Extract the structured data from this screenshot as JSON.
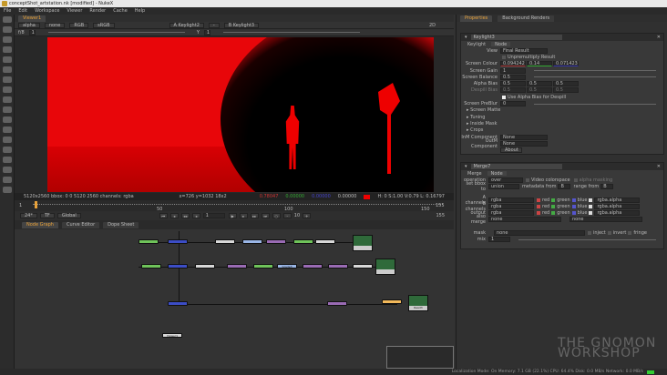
{
  "window": {
    "title": "conceptShot_artstation.nk [modified] - NukeX"
  },
  "menu": [
    "File",
    "Edit",
    "Workspace",
    "Viewer",
    "Render",
    "Cache",
    "Help"
  ],
  "viewer": {
    "tab": "Viewer1",
    "controls": {
      "channel": "alpha",
      "mask": "none",
      "display": "RGB",
      "colorspace": "sRGB",
      "input_a": "A  Keylight2",
      "dash": "-",
      "input_b": "B  Keylight3",
      "gain": "f/8",
      "gain_val": "1",
      "gamma_label": "Y",
      "gamma_val": "1",
      "zoom": "2D"
    },
    "info": {
      "format": "5120x2560  bbox: 0 0 5120 2560 channels: rgba",
      "coords": "x=726 y=1032 18x2",
      "r": "0.78047",
      "g": "0.00000",
      "b": "0.00000",
      "a": "0.00000",
      "hsv": "H: 0 S:1.00 V:0.79  L: 0.16797"
    },
    "sample_color": "#e00000",
    "timeline": {
      "labels": [
        "1",
        "50",
        "100",
        "150",
        "155"
      ],
      "frame": "1",
      "fps": "24*",
      "tf": "TF",
      "range": "Global",
      "increment": "10",
      "end": "155"
    }
  },
  "nodegraph": {
    "tabs": [
      "Node Graph",
      "Curve Editor",
      "Dope Sheet"
    ],
    "nodes": [
      "Read3",
      "Grade3",
      "Viewer1"
    ]
  },
  "properties": {
    "tabs": [
      "Properties",
      "Background Renders"
    ],
    "keylight": {
      "name": "Keylight3",
      "tabs": [
        "Keylight",
        "Node"
      ],
      "view": "Final Result",
      "unpremult": "Unpremultiply Result",
      "rows": [
        {
          "label": "Screen Colour",
          "values": [
            "0.094242",
            "0.14",
            "0.071423"
          ]
        },
        {
          "label": "Screen Gain",
          "values": [
            "1"
          ]
        },
        {
          "label": "Screen Balance",
          "values": [
            "0.5"
          ]
        },
        {
          "label": "Alpha Bias",
          "values": [
            "0.5",
            "0.5",
            "0.5"
          ]
        },
        {
          "label": "Despill Bias",
          "values": [
            "0.5",
            "0.5",
            "0.5"
          ]
        }
      ],
      "view_label": "View",
      "use_alpha_bias": "Use Alpha Bias for Despill",
      "preblur_label": "Screen PreBlur",
      "preblur": "0",
      "groups": [
        "Screen Matte",
        "Tuning",
        "Inside Mask",
        "Crops"
      ],
      "inm_label": "InM Component",
      "inm": "None",
      "outm_label": "OutM Component",
      "outm": "None",
      "about": "About"
    },
    "merge": {
      "name": "Merge7",
      "tabs": [
        "Merge",
        "Node"
      ],
      "operation_label": "operation",
      "operation": "over",
      "video_colorspace": "Video colorspace",
      "alpha_masking": "alpha masking",
      "bbox_label": "set bbox to",
      "bbox": "union",
      "metadata_label": "metadata from",
      "metadata": "B",
      "range_label": "range from",
      "range": "B",
      "channels": [
        {
          "label": "A channels",
          "value": "rgba",
          "alpha": "rgba.alpha"
        },
        {
          "label": "B channels",
          "value": "rgba",
          "alpha": "rgba.alpha"
        },
        {
          "label": "output",
          "value": "rgba",
          "alpha": "rgba.alpha"
        }
      ],
      "ch_names": [
        "red",
        "green",
        "blue"
      ],
      "also_merge_label": "also merge",
      "also_merge": "none",
      "also_merge2": "none",
      "mask_label": "mask",
      "mask": "none",
      "inject": "inject",
      "invert": "invert",
      "fringe": "fringe",
      "mix_label": "mix",
      "mix": "1"
    }
  },
  "status": "Localization Mode: On  Memory: 7.1 GB (22.1%)  CPU: 64.4%  Disk: 0.0 MB/s  Network: 0.0 MB/s",
  "watermark": {
    "line1": "THE GNOMON",
    "line2": "WORKSHOP"
  }
}
